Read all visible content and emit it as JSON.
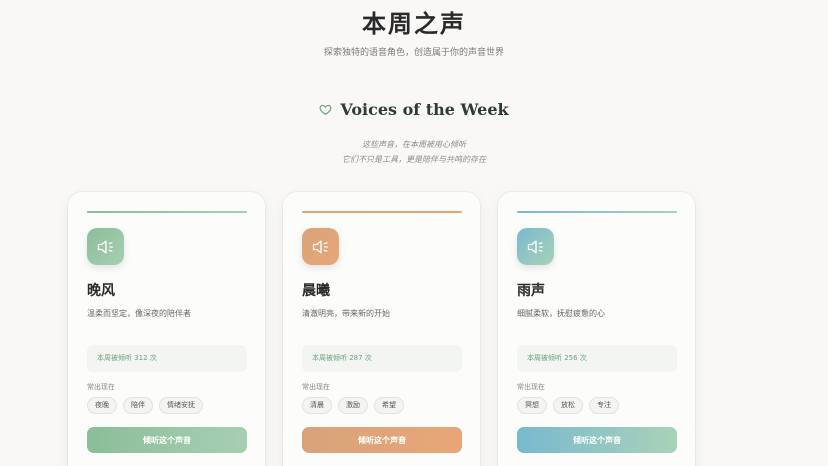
{
  "header": {
    "title": "本周之声",
    "subtitle": "探索独特的语音角色，创造属于你的声音世界"
  },
  "section": {
    "heading": "Voices of the Week",
    "heading_icon": "heart-icon",
    "intro_line1": "这些声音，在本周被用心倾听",
    "intro_line2": "它们不只是工具，更是陪伴与共鸣的存在"
  },
  "cards": [
    {
      "name": "晚风",
      "description": "温柔而坚定，像深夜的陪伴者",
      "stat": "本周被倾听 312 次",
      "common_label": "常出现在",
      "tags": [
        "夜晚",
        "陪伴",
        "情绪安抚"
      ],
      "button_label": "倾听这个声音",
      "icon": "speaker-icon",
      "accent_from": "#8bbd98",
      "accent_to": "#a7cfb3",
      "stat_color": "#6aa27c"
    },
    {
      "name": "晨曦",
      "description": "清澈明亮，带来新的开始",
      "stat": "本周被倾听 287 次",
      "common_label": "常出现在",
      "tags": [
        "清晨",
        "激励",
        "希望"
      ],
      "button_label": "倾听这个声音",
      "icon": "speaker-icon",
      "accent_from": "#d9a37a",
      "accent_to": "#e8a678",
      "stat_color": "#6aa27c"
    },
    {
      "name": "雨声",
      "description": "细腻柔软，抚慰疲惫的心",
      "stat": "本周被倾听 256 次",
      "common_label": "常出现在",
      "tags": [
        "冥想",
        "放松",
        "专注"
      ],
      "button_label": "倾听这个声音",
      "icon": "speaker-icon",
      "accent_from": "#78b9cf",
      "accent_to": "#a9d2b8",
      "stat_color": "#6aa27c"
    }
  ]
}
